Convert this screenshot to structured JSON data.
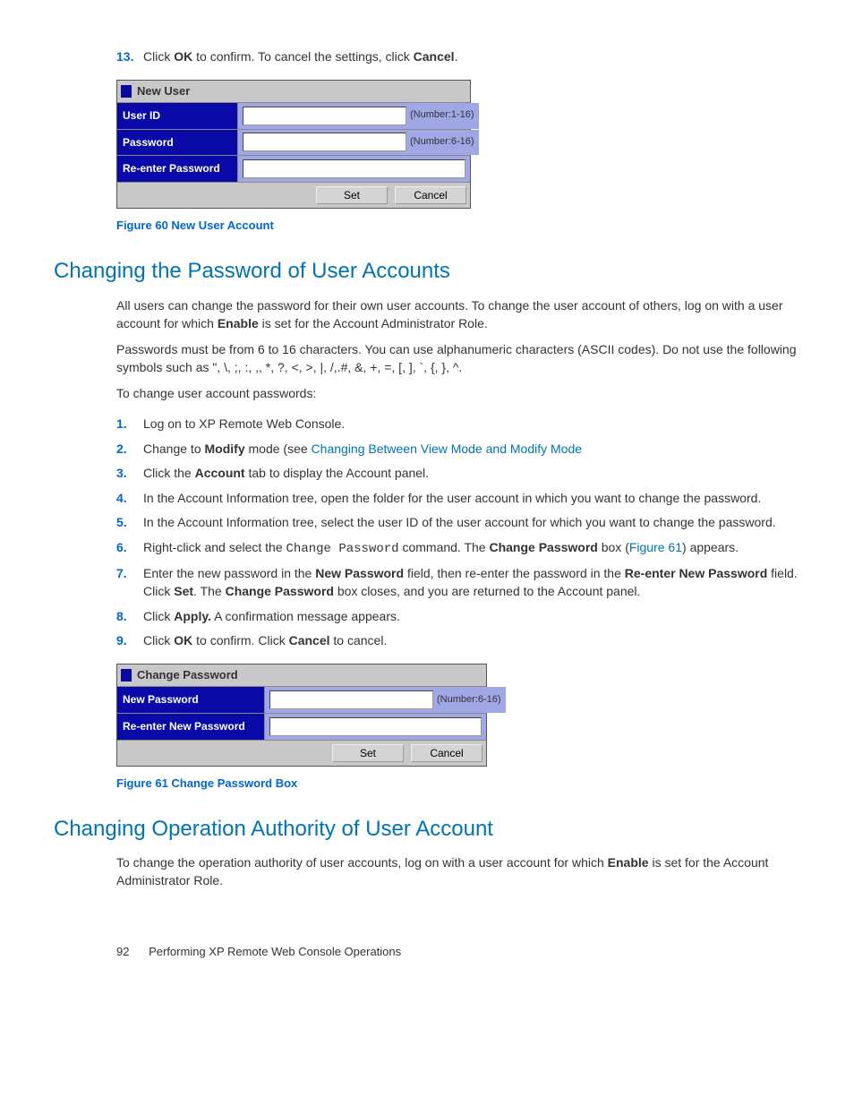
{
  "step13": {
    "prefix": "Click ",
    "b1": "OK",
    "mid": " to confirm. To cancel the settings, click ",
    "b2": "Cancel",
    "end": "."
  },
  "dialog1": {
    "title": "New User",
    "row1_label": "User ID",
    "row1_hint": "(Number:1-16)",
    "row2_label": "Password",
    "row2_hint": "(Number:6-16)",
    "row3_label": "Re-enter Password",
    "set": "Set",
    "cancel": "Cancel"
  },
  "fig60": "Figure 60 New User Account",
  "h2a": "Changing the Password of User Accounts",
  "p1a": "All users can change the password for their own user accounts. To change the user account of others, log on with a user account for which ",
  "p1b": "Enable",
  "p1c": " is set for the Account Administrator Role.",
  "p2": "Passwords must be from 6 to 16 characters. You can use alphanumeric characters (ASCII codes). Do not use the following symbols such as \", \\, ;, :, ,, *, ?, <, >, |, /,.#, &, +, =, [, ], `, {, }, ^.",
  "p3": "To change user account passwords:",
  "steps": {
    "s1": "Log on to XP Remote Web Console.",
    "s2a": "Change to ",
    "s2b": "Modify",
    "s2c": " mode (see ",
    "s2link": "Changing Between View Mode and Modify Mode",
    "s3a": "Click the ",
    "s3b": "Account",
    "s3c": " tab to display the Account panel.",
    "s4": "In the Account Information tree, open the folder for the user account in which you want to change the password.",
    "s5": "In the Account Information tree, select the user ID of the user account for which you want to change the password.",
    "s6a": "Right-click and select the ",
    "s6b": "Change Password",
    "s6c": " command. The ",
    "s6d": "Change Password",
    "s6e": " box (",
    "s6link": "Figure 61",
    "s6f": ") appears.",
    "s7a": "Enter the new password in the ",
    "s7b": "New Password",
    "s7c": " field, then re-enter the password in the ",
    "s7d": "Re-enter New Password",
    "s7e": " field. Click ",
    "s7f": "Set",
    "s7g": ". The ",
    "s7h": "Change Password",
    "s7i": " box closes, and you are returned to the Account panel.",
    "s8a": "Click ",
    "s8b": "Apply.",
    "s8c": " A confirmation message appears.",
    "s9a": "Click ",
    "s9b": "OK",
    "s9c": " to confirm. Click ",
    "s9d": "Cancel",
    "s9e": " to cancel."
  },
  "dialog2": {
    "title": "Change Password",
    "row1_label": "New Password",
    "row1_hint": "(Number:6-16)",
    "row2_label": "Re-enter New Password",
    "set": "Set",
    "cancel": "Cancel"
  },
  "fig61": "Figure 61 Change Password Box",
  "h2b": "Changing Operation Authority of User Account",
  "p4a": "To change the operation authority of user accounts, log on with a user account for which ",
  "p4b": "Enable",
  "p4c": " is set for the Account Administrator Role.",
  "footer_page": "92",
  "footer_text": "Performing XP Remote Web Console Operations"
}
